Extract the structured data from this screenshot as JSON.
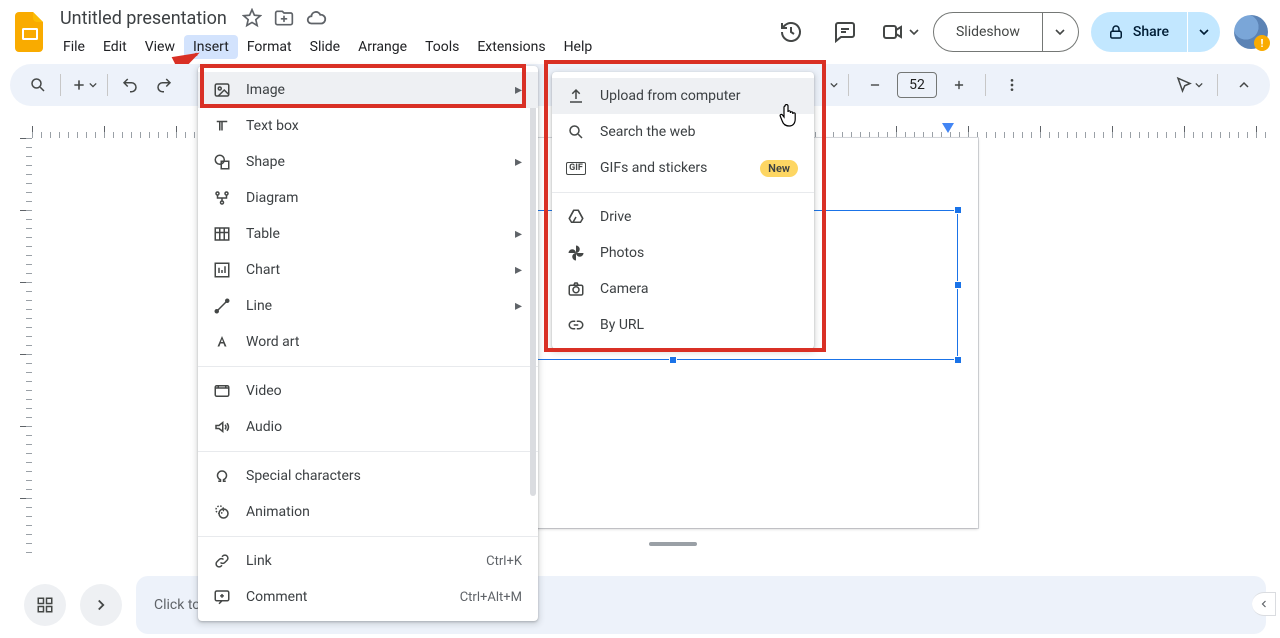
{
  "doc": {
    "title": "Untitled presentation"
  },
  "menubar": [
    "File",
    "Edit",
    "View",
    "Insert",
    "Format",
    "Slide",
    "Arrange",
    "Tools",
    "Extensions",
    "Help"
  ],
  "menubar_open_index": 3,
  "toolbar": {
    "font_size": "52"
  },
  "slideshow_label": "Slideshow",
  "share_label": "Share",
  "insert_menu": {
    "items": [
      {
        "label": "Image",
        "submenu": true,
        "hovered": true
      },
      {
        "label": "Text box"
      },
      {
        "label": "Shape",
        "submenu": true
      },
      {
        "label": "Diagram"
      },
      {
        "label": "Table",
        "submenu": true
      },
      {
        "label": "Chart",
        "submenu": true
      },
      {
        "label": "Line",
        "submenu": true
      },
      {
        "label": "Word art"
      },
      {
        "sep": true
      },
      {
        "label": "Video"
      },
      {
        "label": "Audio"
      },
      {
        "sep": true
      },
      {
        "label": "Special characters"
      },
      {
        "label": "Animation"
      },
      {
        "sep": true
      },
      {
        "label": "Link",
        "shortcut": "Ctrl+K"
      },
      {
        "label": "Comment",
        "shortcut": "Ctrl+Alt+M"
      }
    ]
  },
  "image_submenu": {
    "items": [
      {
        "label": "Upload from computer",
        "hovered": true
      },
      {
        "label": "Search the web"
      },
      {
        "label": "GIFs and stickers",
        "badge": "New"
      },
      {
        "sep": true
      },
      {
        "label": "Drive"
      },
      {
        "label": "Photos"
      },
      {
        "label": "Camera"
      },
      {
        "label": "By URL"
      }
    ]
  },
  "speaker_notes_prompt": "Click to"
}
